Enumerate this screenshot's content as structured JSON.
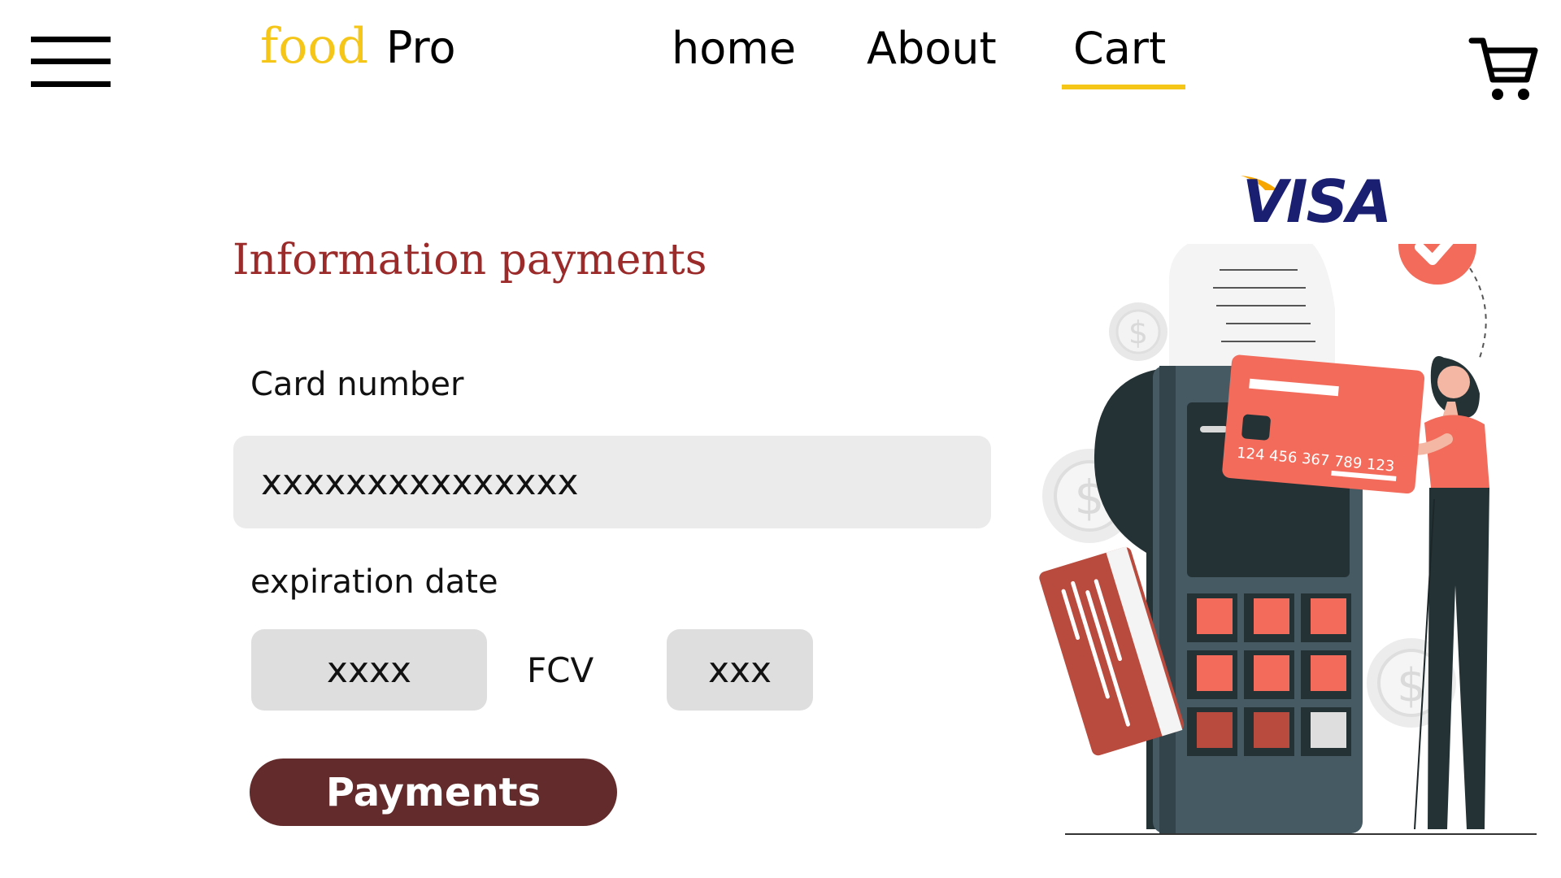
{
  "header": {
    "brand": {
      "food": "food",
      "pro": "Pro"
    },
    "nav": {
      "home": "home",
      "about": "About",
      "cart": "Cart"
    },
    "active_nav": "Cart",
    "accent_color": "#f5c518"
  },
  "icons": {
    "menu": "hamburger-menu-icon",
    "cart": "shopping-cart-icon"
  },
  "form": {
    "title": "Information payments",
    "card_label": "Card number",
    "card_placeholder": "xxxxxxxxxxxxxxx",
    "expiration_label": "expiration date",
    "expiration_placeholder": "xxxx",
    "fcv_label": "FCV",
    "fcv_placeholder": "xxx",
    "pay_button": "Payments"
  },
  "illustration": {
    "brand_logo": "VISA",
    "card_number_printed": "124 456 367 789 123"
  },
  "colors": {
    "title": "#9b2b2b",
    "button": "#632b2b",
    "visa": "#1a1f71",
    "coral": "#f26b5b"
  }
}
